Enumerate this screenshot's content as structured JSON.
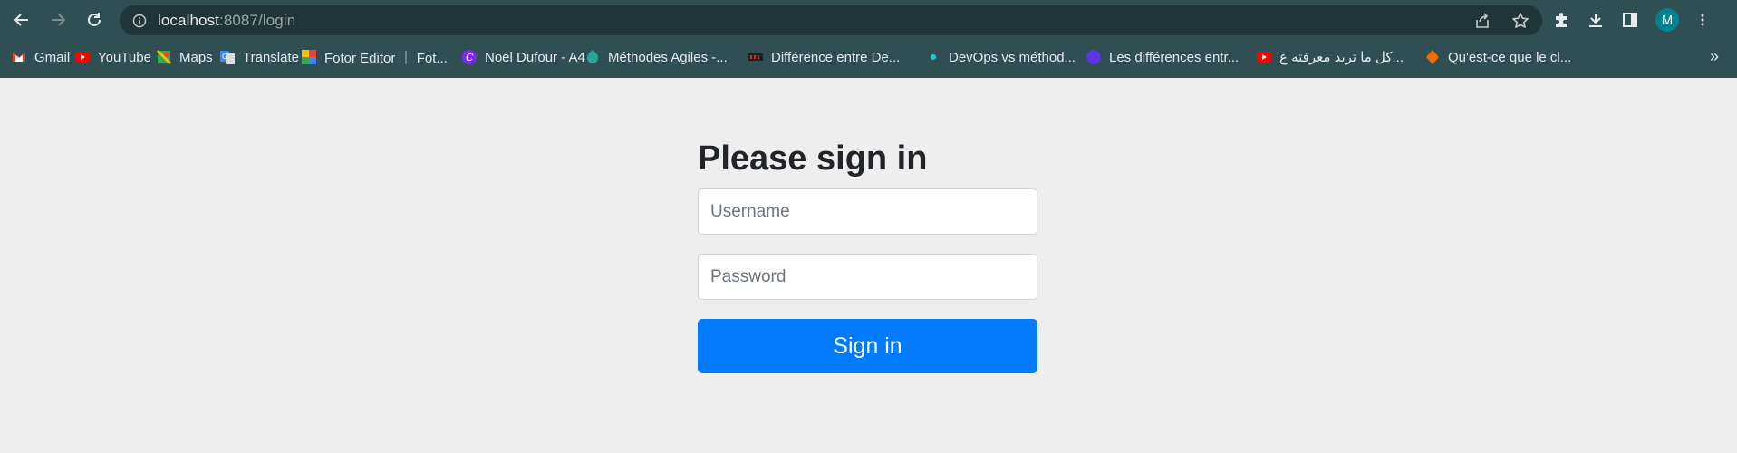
{
  "browser": {
    "url_host": "localhost",
    "url_rest": ":8087/login",
    "profile_initial": "M",
    "more_bookmarks": "»",
    "bookmarks": [
      {
        "label": "Gmail",
        "icon": "gmail-icon"
      },
      {
        "label": "YouTube",
        "icon": "youtube-icon"
      },
      {
        "label": "Maps",
        "icon": "maps-icon"
      },
      {
        "label": "Translate",
        "icon": "translate-icon"
      },
      {
        "label": "Fotor Editor ｜ Fot...",
        "icon": "fotor-icon"
      },
      {
        "label": "Noël Dufour - A4",
        "icon": "canva-icon"
      },
      {
        "label": "Méthodes Agiles -...",
        "icon": "agile-icon"
      },
      {
        "label": "Différence entre De...",
        "icon": "site-icon"
      },
      {
        "label": "DevOps vs méthod...",
        "icon": "dot-icon"
      },
      {
        "label": "Les différences entr...",
        "icon": "globe-icon"
      },
      {
        "label": "كل ما تريد معرفته ع...",
        "icon": "youtube-icon"
      },
      {
        "label": "Qu'est-ce que le cl...",
        "icon": "puzzle-icon"
      }
    ]
  },
  "login": {
    "heading": "Please sign in",
    "username_placeholder": "Username",
    "password_placeholder": "Password",
    "submit_label": "Sign in"
  },
  "colors": {
    "chrome": "#2f4f52",
    "page_bg": "#eeeeee",
    "primary": "#007bff"
  }
}
